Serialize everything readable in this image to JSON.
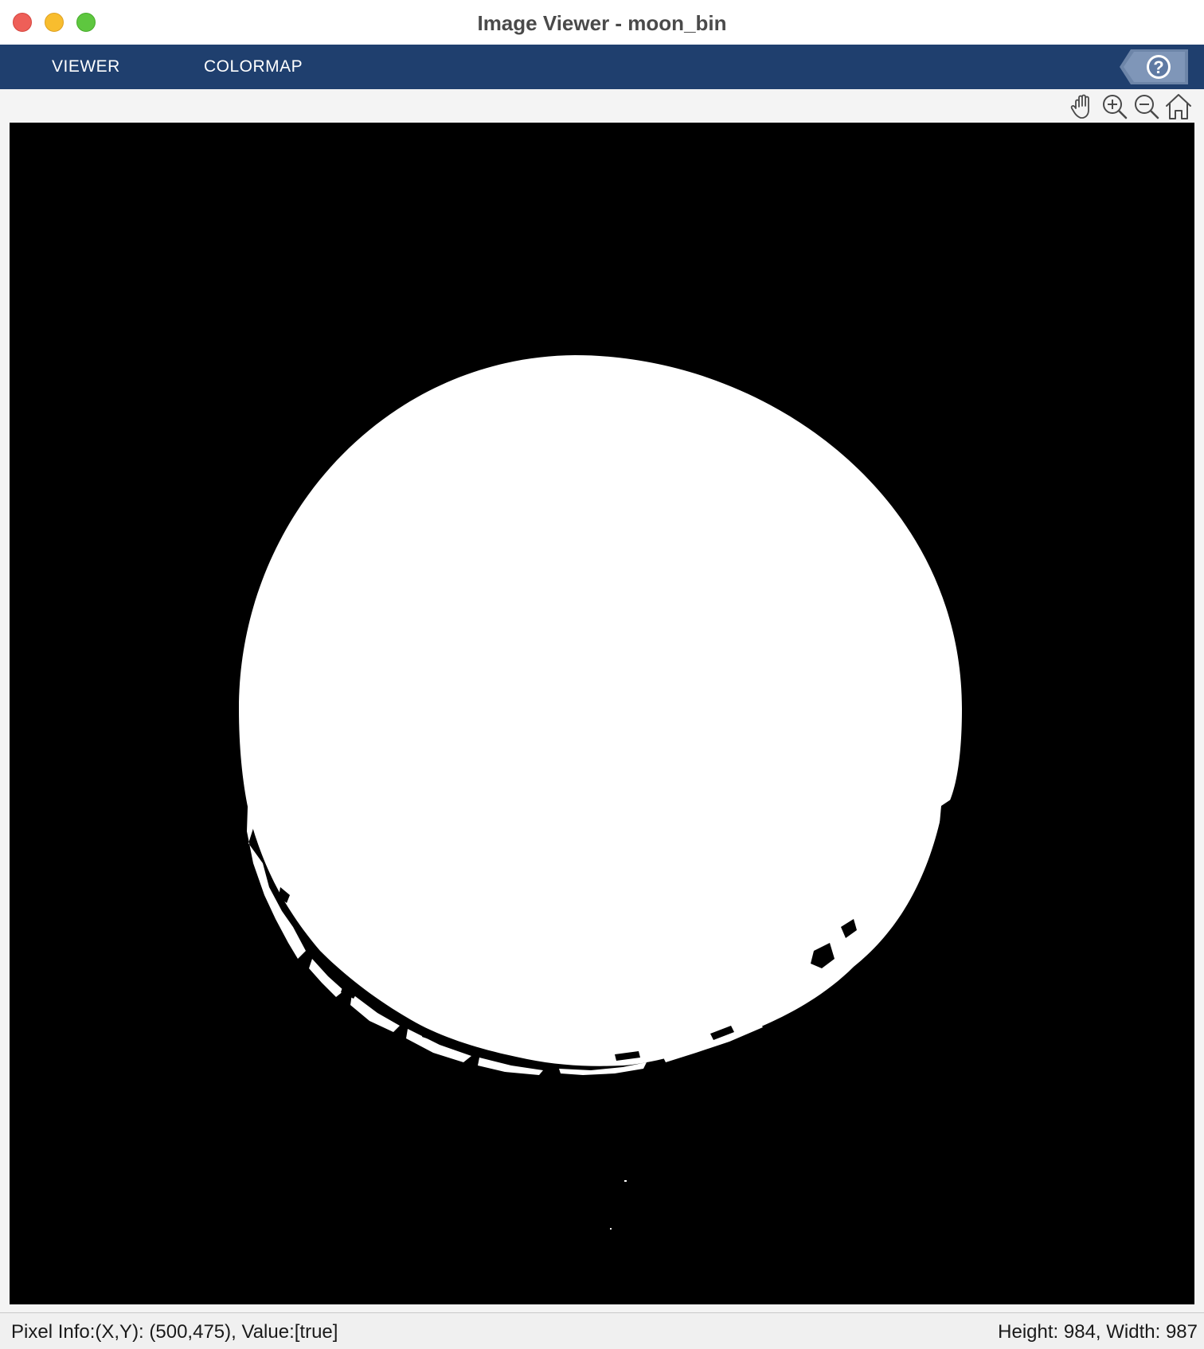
{
  "window": {
    "title": "Image Viewer - moon_bin"
  },
  "tabs": [
    {
      "label": "VIEWER"
    },
    {
      "label": "COLORMAP"
    }
  ],
  "help": {
    "icon": "help-icon"
  },
  "toolbar": {
    "tools": [
      {
        "icon": "pan-hand-icon"
      },
      {
        "icon": "zoom-in-icon"
      },
      {
        "icon": "zoom-out-icon"
      },
      {
        "icon": "home-icon"
      }
    ]
  },
  "image": {
    "name": "moon_bin",
    "colors": {
      "background": "#000000",
      "foreground": "#ffffff"
    }
  },
  "status": {
    "pixel_info": "Pixel Info:(X,Y): (500,475), Value:[true]",
    "dimensions": "Height: 984, Width: 987"
  },
  "colors": {
    "tabstrip": "#1f3f6e",
    "close": "#ee5f58",
    "minimize": "#f8bd2e",
    "maximize": "#5ec73f"
  }
}
